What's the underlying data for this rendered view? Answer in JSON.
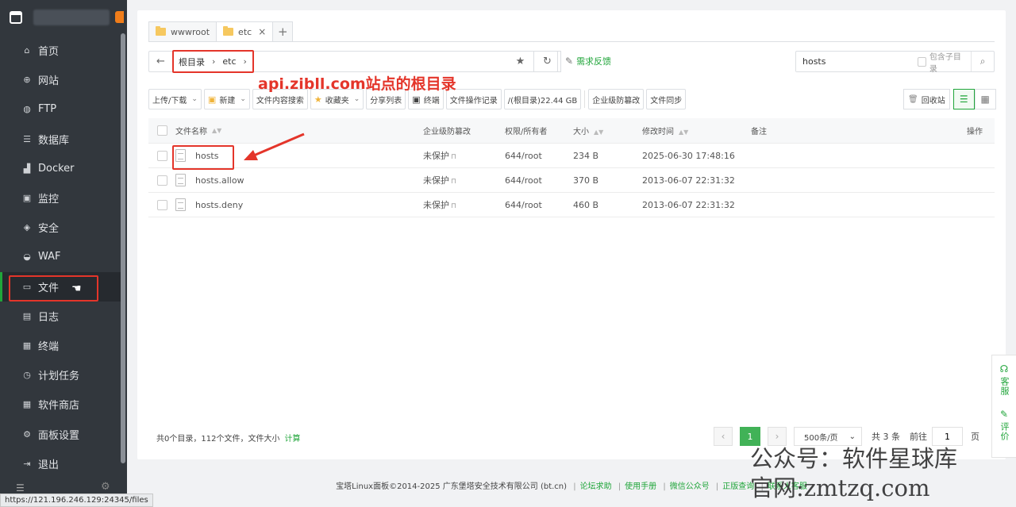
{
  "sidebar": {
    "items": [
      {
        "label": "首页",
        "icon": "home-icon",
        "glyph": "⌂"
      },
      {
        "label": "网站",
        "icon": "globe-icon",
        "glyph": "⊕"
      },
      {
        "label": "FTP",
        "icon": "ftp-icon",
        "glyph": "◍"
      },
      {
        "label": "数据库",
        "icon": "database-icon",
        "glyph": "☰"
      },
      {
        "label": "Docker",
        "icon": "docker-icon",
        "glyph": "▟"
      },
      {
        "label": "监控",
        "icon": "monitor-icon",
        "glyph": "▣"
      },
      {
        "label": "安全",
        "icon": "shield-icon",
        "glyph": "◈"
      },
      {
        "label": "WAF",
        "icon": "waf-icon",
        "glyph": "◒"
      },
      {
        "label": "文件",
        "icon": "folder-icon",
        "glyph": "▭",
        "active": true
      },
      {
        "label": "日志",
        "icon": "log-icon",
        "glyph": "▤"
      },
      {
        "label": "终端",
        "icon": "terminal-icon",
        "glyph": "▦"
      },
      {
        "label": "计划任务",
        "icon": "schedule-icon",
        "glyph": "◷"
      },
      {
        "label": "软件商店",
        "icon": "store-icon",
        "glyph": "▦"
      },
      {
        "label": "面板设置",
        "icon": "gear-icon",
        "glyph": "⚙"
      },
      {
        "label": "退出",
        "icon": "logout-icon",
        "glyph": "⇥"
      }
    ]
  },
  "status_url": "https://121.196.246.129:24345/files",
  "tabs": [
    {
      "label": "wwwroot",
      "active": false
    },
    {
      "label": "etc",
      "active": true,
      "close": "×"
    }
  ],
  "tab_add": "+",
  "path": {
    "back": "←",
    "crumbs": [
      "根目录",
      "etc"
    ],
    "sep": "›"
  },
  "path_actions": {
    "star": "★",
    "refresh": "↻"
  },
  "feedback": "需求反馈",
  "search": {
    "value": "hosts",
    "subdir_label": "包含子目录",
    "button": "⌕"
  },
  "toolbar": {
    "upload": "上传/下载",
    "new": "新建",
    "content_search": "文件内容搜索",
    "favorites": "收藏夹",
    "share_list": "分享列表",
    "terminal": "终端",
    "op_log": "文件操作记录",
    "disk": "/(根目录)22.44 GB",
    "tamper": "企业级防篡改",
    "sync": "文件同步",
    "recycle": "回收站"
  },
  "table": {
    "headers": {
      "name": "文件名称",
      "protect": "企业级防篡改",
      "perm": "权限/所有者",
      "size": "大小",
      "mtime": "修改时间",
      "note": "备注",
      "op": "操作"
    },
    "rows": [
      {
        "name": "hosts",
        "protect": "未保护",
        "perm": "644/root",
        "size": "234 B",
        "mtime": "2025-06-30 17:48:16"
      },
      {
        "name": "hosts.allow",
        "protect": "未保护",
        "perm": "644/root",
        "size": "370 B",
        "mtime": "2013-06-07 22:31:32"
      },
      {
        "name": "hosts.deny",
        "protect": "未保护",
        "perm": "644/root",
        "size": "460 B",
        "mtime": "2013-06-07 22:31:32"
      }
    ]
  },
  "summary": {
    "text": "共0个目录，112个文件，文件大小",
    "calc": "计算"
  },
  "pager": {
    "prev": "‹",
    "current": "1",
    "next": "›",
    "page_size": "500条/页",
    "total": "共 3 条",
    "goto_label": "前往",
    "goto_value": "1",
    "page_unit": "页"
  },
  "footer": {
    "copyright": "宝塔Linux面板©2014-2025 广东堡塔安全技术有限公司 (bt.cn)",
    "links": [
      "论坛求助",
      "使用手册",
      "微信公众号",
      "正版查询",
      "联系人客服"
    ]
  },
  "side_panel": {
    "service": "客服",
    "review": "评价"
  },
  "annotation": "api.zibll.com站点的根目录",
  "watermark": {
    "line1": "公众号：软件星球库",
    "line2": "官网:zmtzq.com"
  },
  "colors": {
    "accent": "#20a53a",
    "annotation": "#e4352a",
    "sidebar": "#32373d"
  }
}
